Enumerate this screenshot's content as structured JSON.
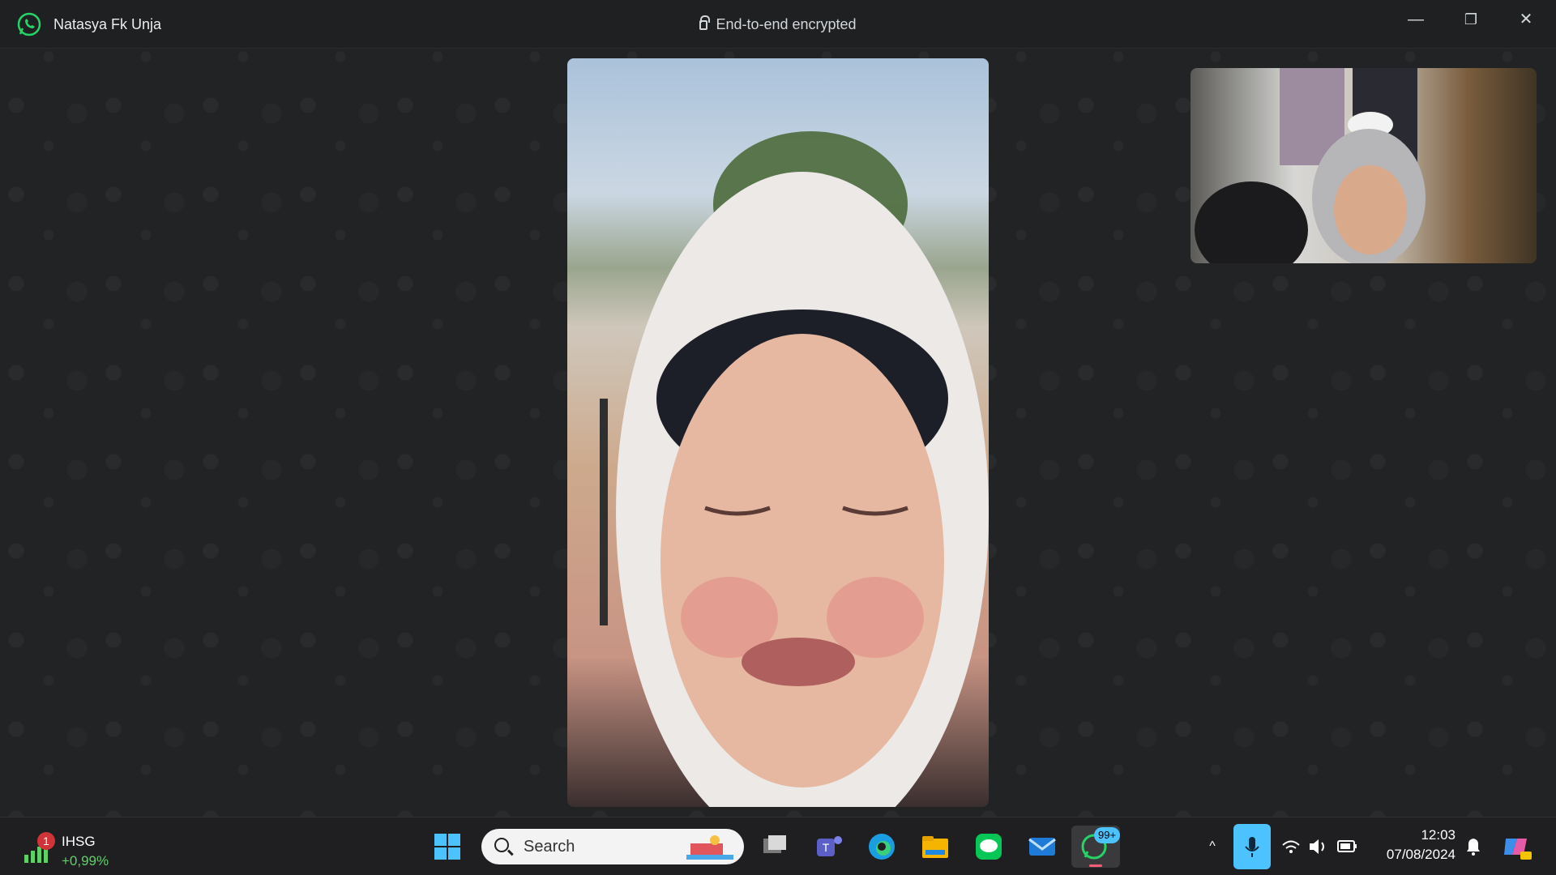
{
  "window": {
    "contact_name": "Natasya Fk Unja",
    "encryption_label": "End-to-end encrypted",
    "controls": {
      "minimize": "—",
      "restore": "❐",
      "close": "✕"
    }
  },
  "call": {
    "main_video": "remote-participant-video",
    "self_view": "self-camera-preview"
  },
  "taskbar": {
    "widget": {
      "badge": "1",
      "ticker": "IHSG",
      "change": "+0,99%"
    },
    "search": {
      "label": "Search"
    },
    "whatsapp_badge": "99+",
    "clock": {
      "time": "12:03",
      "date": "07/08/2024"
    }
  },
  "colors": {
    "accent_green": "#25d366",
    "positive": "#5fd068",
    "badge_red": "#d13438",
    "mic_blue": "#4cc2ff"
  }
}
